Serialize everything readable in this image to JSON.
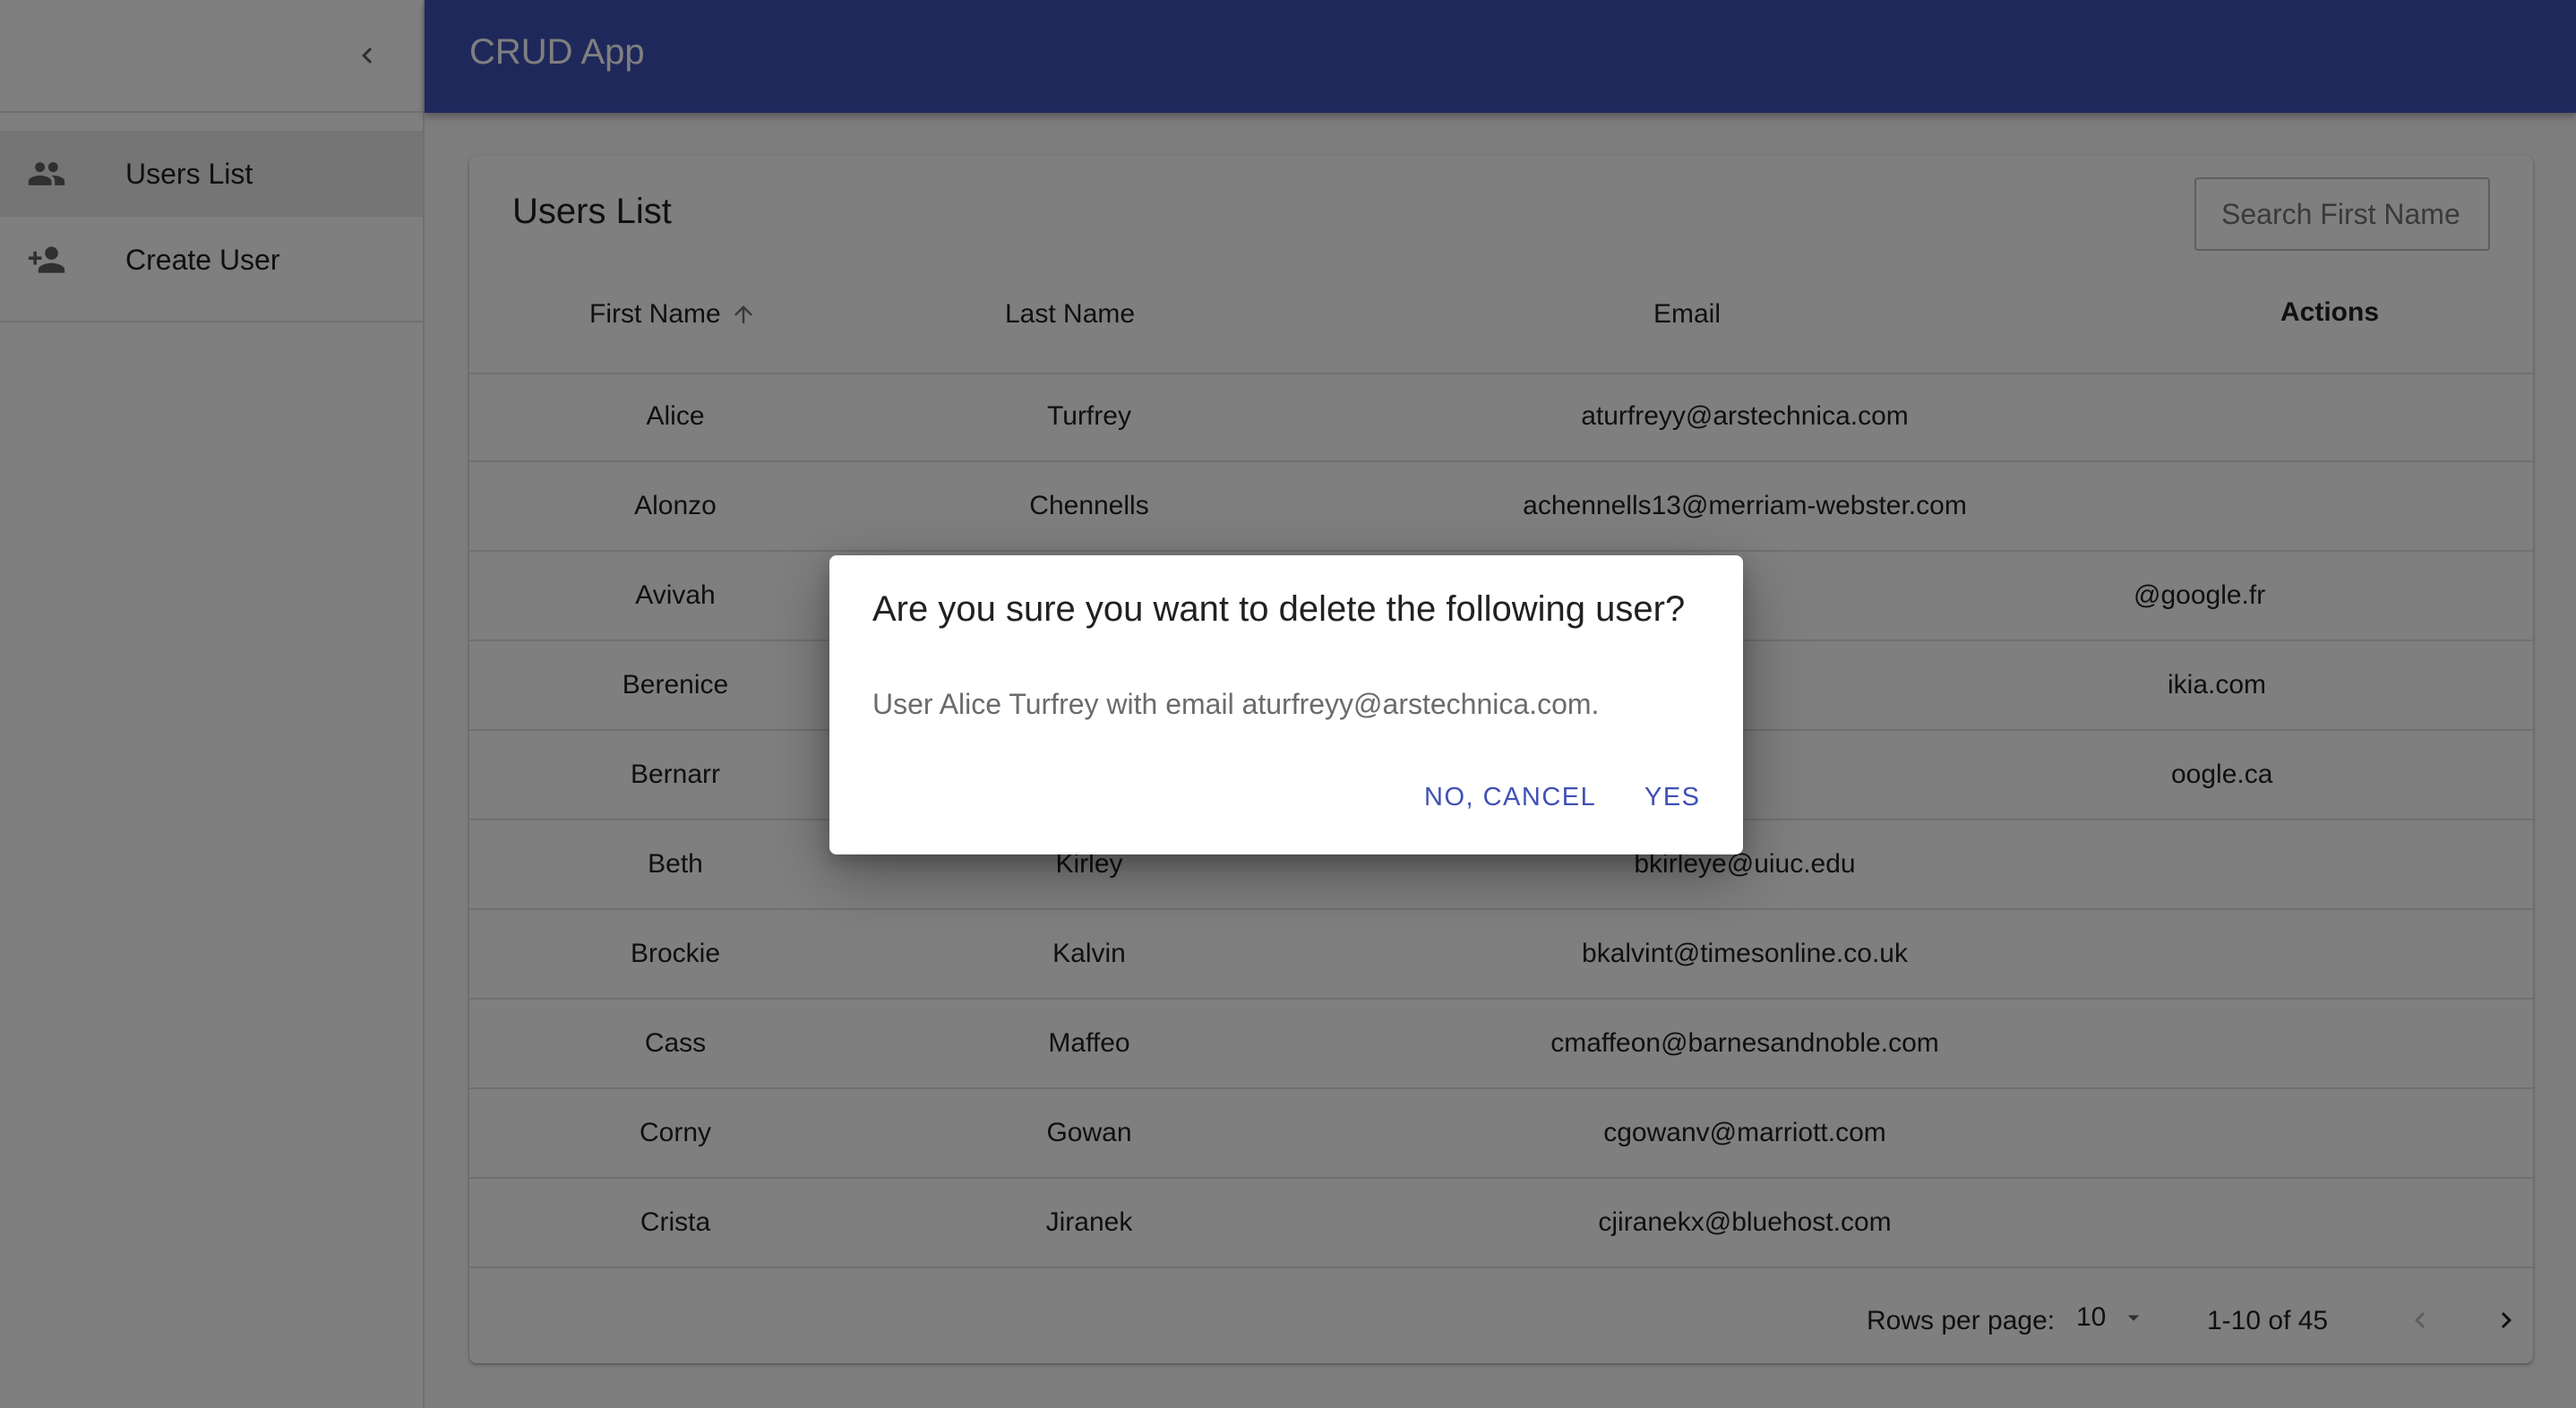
{
  "app": {
    "title": "CRUD App"
  },
  "sidebar": {
    "items": [
      {
        "label": "Users List",
        "icon": "people-icon",
        "active": true
      },
      {
        "label": "Create User",
        "icon": "person-add-icon",
        "active": false
      }
    ]
  },
  "page": {
    "title": "Users List",
    "search_placeholder": "Search First Name"
  },
  "table": {
    "columns": {
      "first_name": "First Name",
      "last_name": "Last Name",
      "email": "Email",
      "actions": "Actions"
    },
    "sort": {
      "column": "First Name",
      "direction": "asc"
    },
    "rows": [
      {
        "first": "Alice",
        "last": "Turfrey",
        "email": "aturfreyy@arstechnica.com"
      },
      {
        "first": "Alonzo",
        "last": "Chennells",
        "email": "achennells13@merriam-webster.com"
      },
      {
        "first": "Avivah",
        "last": "",
        "email": "@google.fr"
      },
      {
        "first": "Berenice",
        "last": "",
        "email": "ikia.com"
      },
      {
        "first": "Bernarr",
        "last": "",
        "email": "oogle.ca"
      },
      {
        "first": "Beth",
        "last": "Kirley",
        "email": "bkirleye@uiuc.edu"
      },
      {
        "first": "Brockie",
        "last": "Kalvin",
        "email": "bkalvint@timesonline.co.uk"
      },
      {
        "first": "Cass",
        "last": "Maffeo",
        "email": "cmaffeon@barnesandnoble.com"
      },
      {
        "first": "Corny",
        "last": "Gowan",
        "email": "cgowanv@marriott.com"
      },
      {
        "first": "Crista",
        "last": "Jiranek",
        "email": "cjiranekx@bluehost.com"
      }
    ]
  },
  "pagination": {
    "rows_per_page_label": "Rows per page:",
    "rows_per_page": "10",
    "range": "1-10 of 45"
  },
  "dialog": {
    "title": "Are you sure you want to delete the following user?",
    "body": "User Alice Turfrey with email aturfreyy@arstechnica.com.",
    "cancel_label": "NO, CANCEL",
    "confirm_label": "YES"
  },
  "colors": {
    "primary": "#3f51b5",
    "overlay": "rgba(0,0,0,0.5)"
  }
}
